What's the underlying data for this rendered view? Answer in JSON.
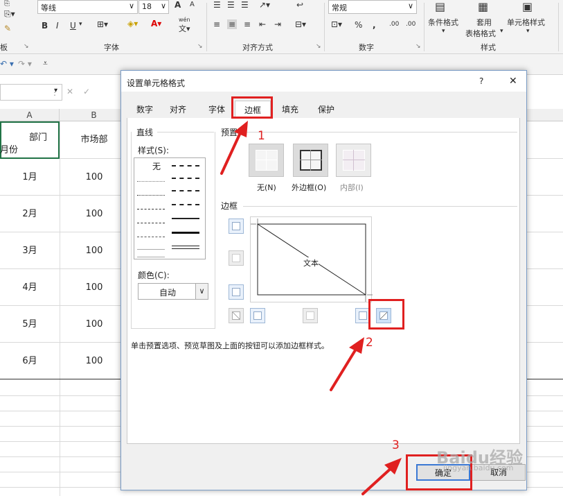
{
  "ribbon": {
    "font_name": "等线",
    "font_size": "18",
    "number_format": "常规",
    "grow_font": "A",
    "shrink_font": "A",
    "bold": "B",
    "italic": "I",
    "underline": "U",
    "phonetic": "wén",
    "percent": "%",
    "comma": ",",
    "inc_decimal": ".00",
    "dec_decimal": ".00",
    "clipboard_label": "板",
    "font_group_label": "字体",
    "align_group_label": "对齐方式",
    "number_group_label": "数字",
    "styles_group_label": "样式",
    "conditional_format": "条件格式",
    "format_as_table_1": "套用",
    "format_as_table_2": "表格格式",
    "cell_styles": "单元格样式"
  },
  "sheet": {
    "columns": [
      "A",
      "B"
    ],
    "header_dept": "部门",
    "header_month": "月份",
    "header_b": "市场部",
    "rows": [
      {
        "month": "1月",
        "value": "100"
      },
      {
        "month": "2月",
        "value": "100"
      },
      {
        "month": "3月",
        "value": "100"
      },
      {
        "month": "4月",
        "value": "100"
      },
      {
        "month": "5月",
        "value": "100"
      },
      {
        "month": "6月",
        "value": "100"
      }
    ]
  },
  "dialog": {
    "title": "设置单元格格式",
    "help": "?",
    "close": "✕",
    "tabs": [
      "数字",
      "对齐",
      "字体",
      "边框",
      "填充",
      "保护"
    ],
    "active_tab": "边框",
    "line_section": "直线",
    "style_label": "样式(S):",
    "style_none": "无",
    "color_label": "颜色(C):",
    "color_value": "自动",
    "preset_section": "预置",
    "presets": [
      "无(N)",
      "外边框(O)",
      "内部(I)"
    ],
    "border_section": "边框",
    "preview_text": "文本",
    "hint": "单击预置选项、预览草图及上面的按钮可以添加边框样式。",
    "ok": "确定",
    "cancel": "取消"
  },
  "annotations": [
    "1",
    "2",
    "3"
  ],
  "watermark": "Baidu经验",
  "watermark_url": "jingyan.baidu.com",
  "colors": {
    "accent": "#e02020",
    "selected_border": "#217346"
  }
}
